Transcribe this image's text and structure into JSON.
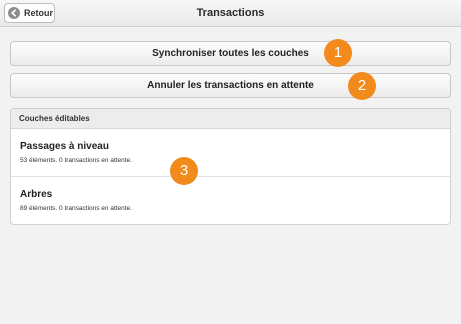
{
  "header": {
    "back_label": "Retour",
    "title": "Transactions"
  },
  "actions": {
    "sync_label": "Synchroniser toutes les couches",
    "cancel_label": "Annuler les transactions en attente"
  },
  "badges": [
    "1",
    "2",
    "3"
  ],
  "layers": {
    "header": "Couches éditables",
    "items": [
      {
        "name": "Passages à niveau",
        "desc": "53 éléments. 0 transactions en attente."
      },
      {
        "name": "Arbres",
        "desc": "89 éléments. 0 transactions en attente."
      }
    ]
  },
  "colors": {
    "badge": "#f28a1c",
    "background": "#f2f2f2"
  }
}
